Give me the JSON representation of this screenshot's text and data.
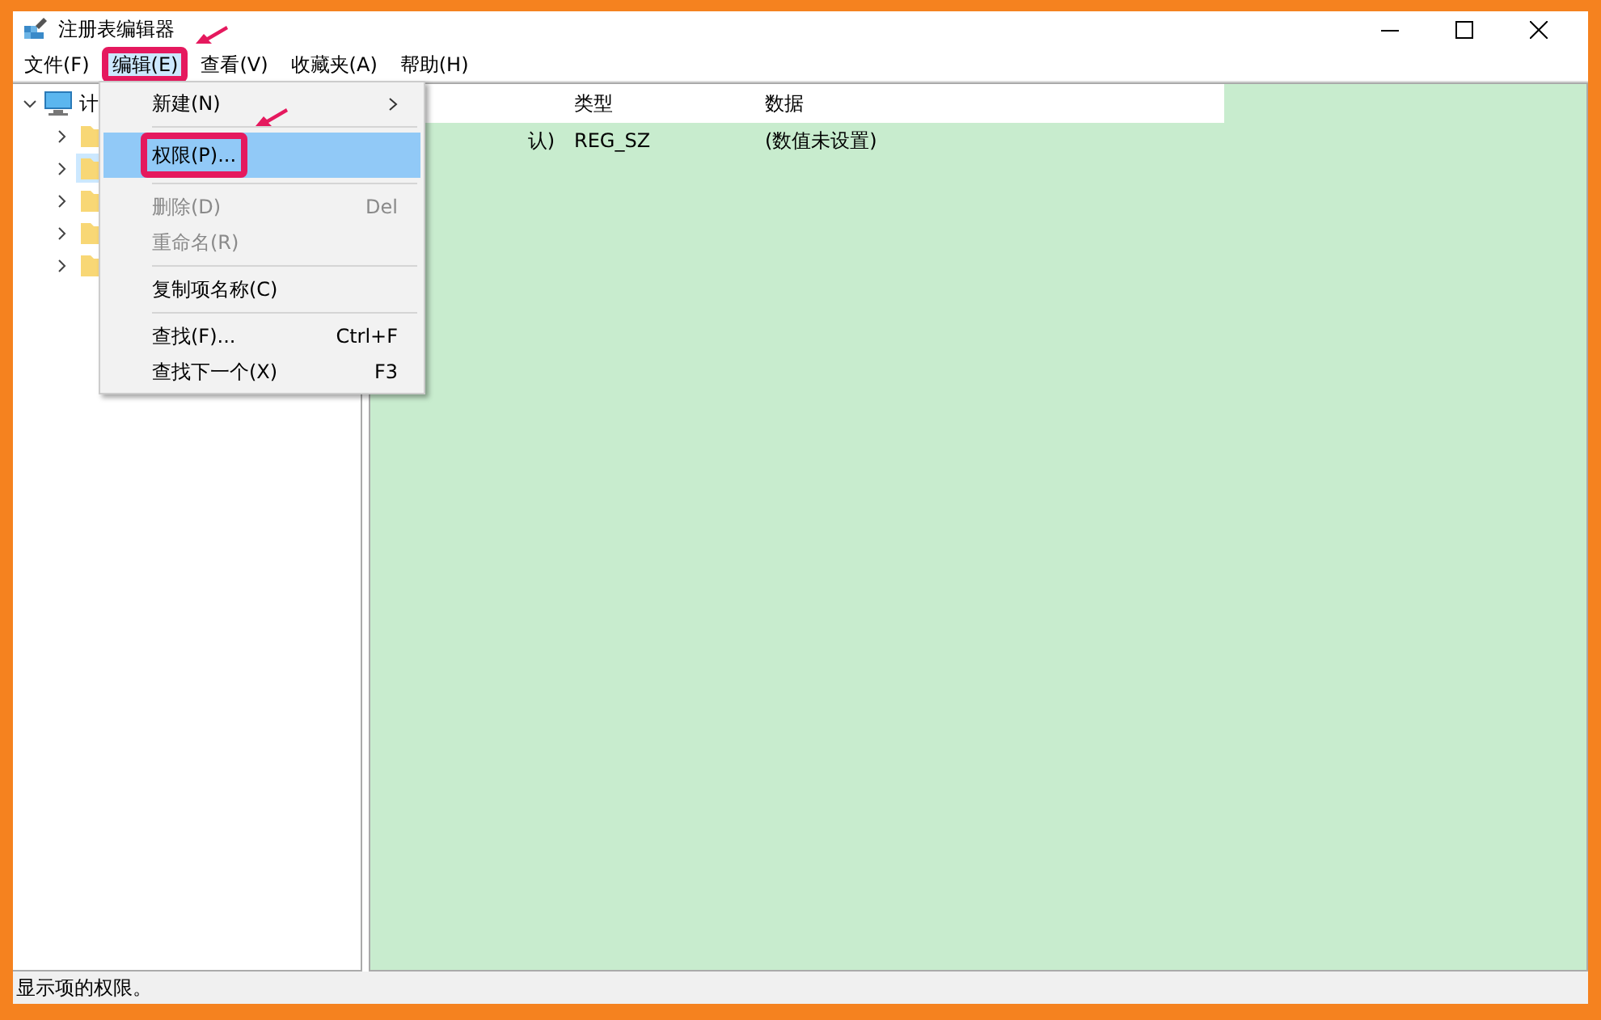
{
  "window": {
    "title": "注册表编辑器"
  },
  "menu_bar": [
    {
      "label": "文件(F)",
      "selected": false,
      "annotated": false
    },
    {
      "label": "编辑(E)",
      "selected": true,
      "annotated": true
    },
    {
      "label": "查看(V)",
      "selected": false,
      "annotated": false
    },
    {
      "label": "收藏夹(A)",
      "selected": false,
      "annotated": false
    },
    {
      "label": "帮助(H)",
      "selected": false,
      "annotated": false
    }
  ],
  "edit_menu": [
    {
      "kind": "item",
      "label": "新建(N)",
      "submenu": true,
      "disabled": false,
      "selected": false,
      "annotated": false
    },
    {
      "kind": "separator"
    },
    {
      "kind": "item",
      "label": "权限(P)...",
      "submenu": false,
      "disabled": false,
      "selected": true,
      "annotated": true
    },
    {
      "kind": "separator"
    },
    {
      "kind": "item",
      "label": "删除(D)",
      "shortcut": "Del",
      "submenu": false,
      "disabled": true,
      "selected": false,
      "annotated": false
    },
    {
      "kind": "item",
      "label": "重命名(R)",
      "submenu": false,
      "disabled": true,
      "selected": false,
      "annotated": false
    },
    {
      "kind": "separator"
    },
    {
      "kind": "item",
      "label": "复制项名称(C)",
      "submenu": false,
      "disabled": false,
      "selected": false,
      "annotated": false
    },
    {
      "kind": "separator"
    },
    {
      "kind": "item",
      "label": "查找(F)...",
      "shortcut": "Ctrl+F",
      "submenu": false,
      "disabled": false,
      "selected": false,
      "annotated": false
    },
    {
      "kind": "item",
      "label": "查找下一个(X)",
      "shortcut": "F3",
      "submenu": false,
      "disabled": false,
      "selected": false,
      "annotated": false
    }
  ],
  "tree": {
    "label": "计",
    "expanded": true,
    "children": [
      {
        "expanded": false,
        "selected": false
      },
      {
        "expanded": false,
        "selected": true
      },
      {
        "expanded": false,
        "selected": false
      },
      {
        "expanded": false,
        "selected": false
      },
      {
        "expanded": false,
        "selected": false
      }
    ]
  },
  "table": {
    "columns": [
      "类型",
      "数据"
    ],
    "rows": [
      {
        "name": "认)",
        "type": "REG_SZ",
        "data": "(数值未设置)"
      }
    ]
  },
  "status_bar": "显示项的权限。"
}
